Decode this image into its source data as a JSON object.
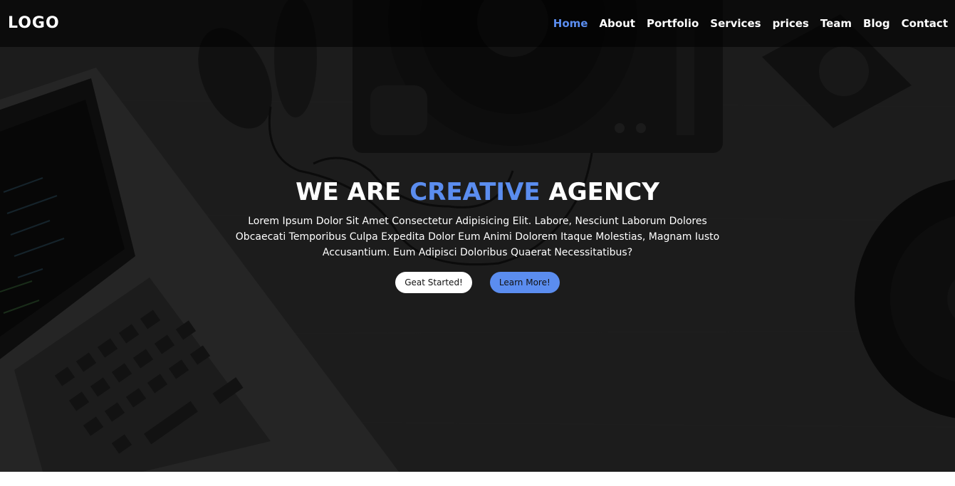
{
  "header": {
    "logo": "LOGO",
    "nav": [
      {
        "label": "Home",
        "active": true
      },
      {
        "label": "About",
        "active": false
      },
      {
        "label": "Portfolio",
        "active": false
      },
      {
        "label": "Services",
        "active": false
      },
      {
        "label": "prices",
        "active": false
      },
      {
        "label": "Team",
        "active": false
      },
      {
        "label": "Blog",
        "active": false
      },
      {
        "label": "Contact",
        "active": false
      }
    ]
  },
  "hero": {
    "headline_pre": "WE ARE ",
    "headline_accent": "CREATIVE",
    "headline_post": " AGENCY",
    "description": "Lorem Ipsum Dolor Sit Amet Consectetur Adipisicing Elit. Labore, Nesciunt Laborum Dolores Obcaecati Temporibus Culpa Expedita Dolor Eum Animi Dolorem Itaque Molestias, Magnam Iusto Accusantium. Eum Adipisci Doloribus Quaerat Necessitatibus?",
    "primary_button": "Geat Started!",
    "secondary_button": "Learn More!",
    "background_image": "desk-with-laptop-headphones-turntable"
  },
  "colors": {
    "accent": "#5b8def",
    "text": "#ffffff",
    "overlay": "#2a2a2a"
  }
}
